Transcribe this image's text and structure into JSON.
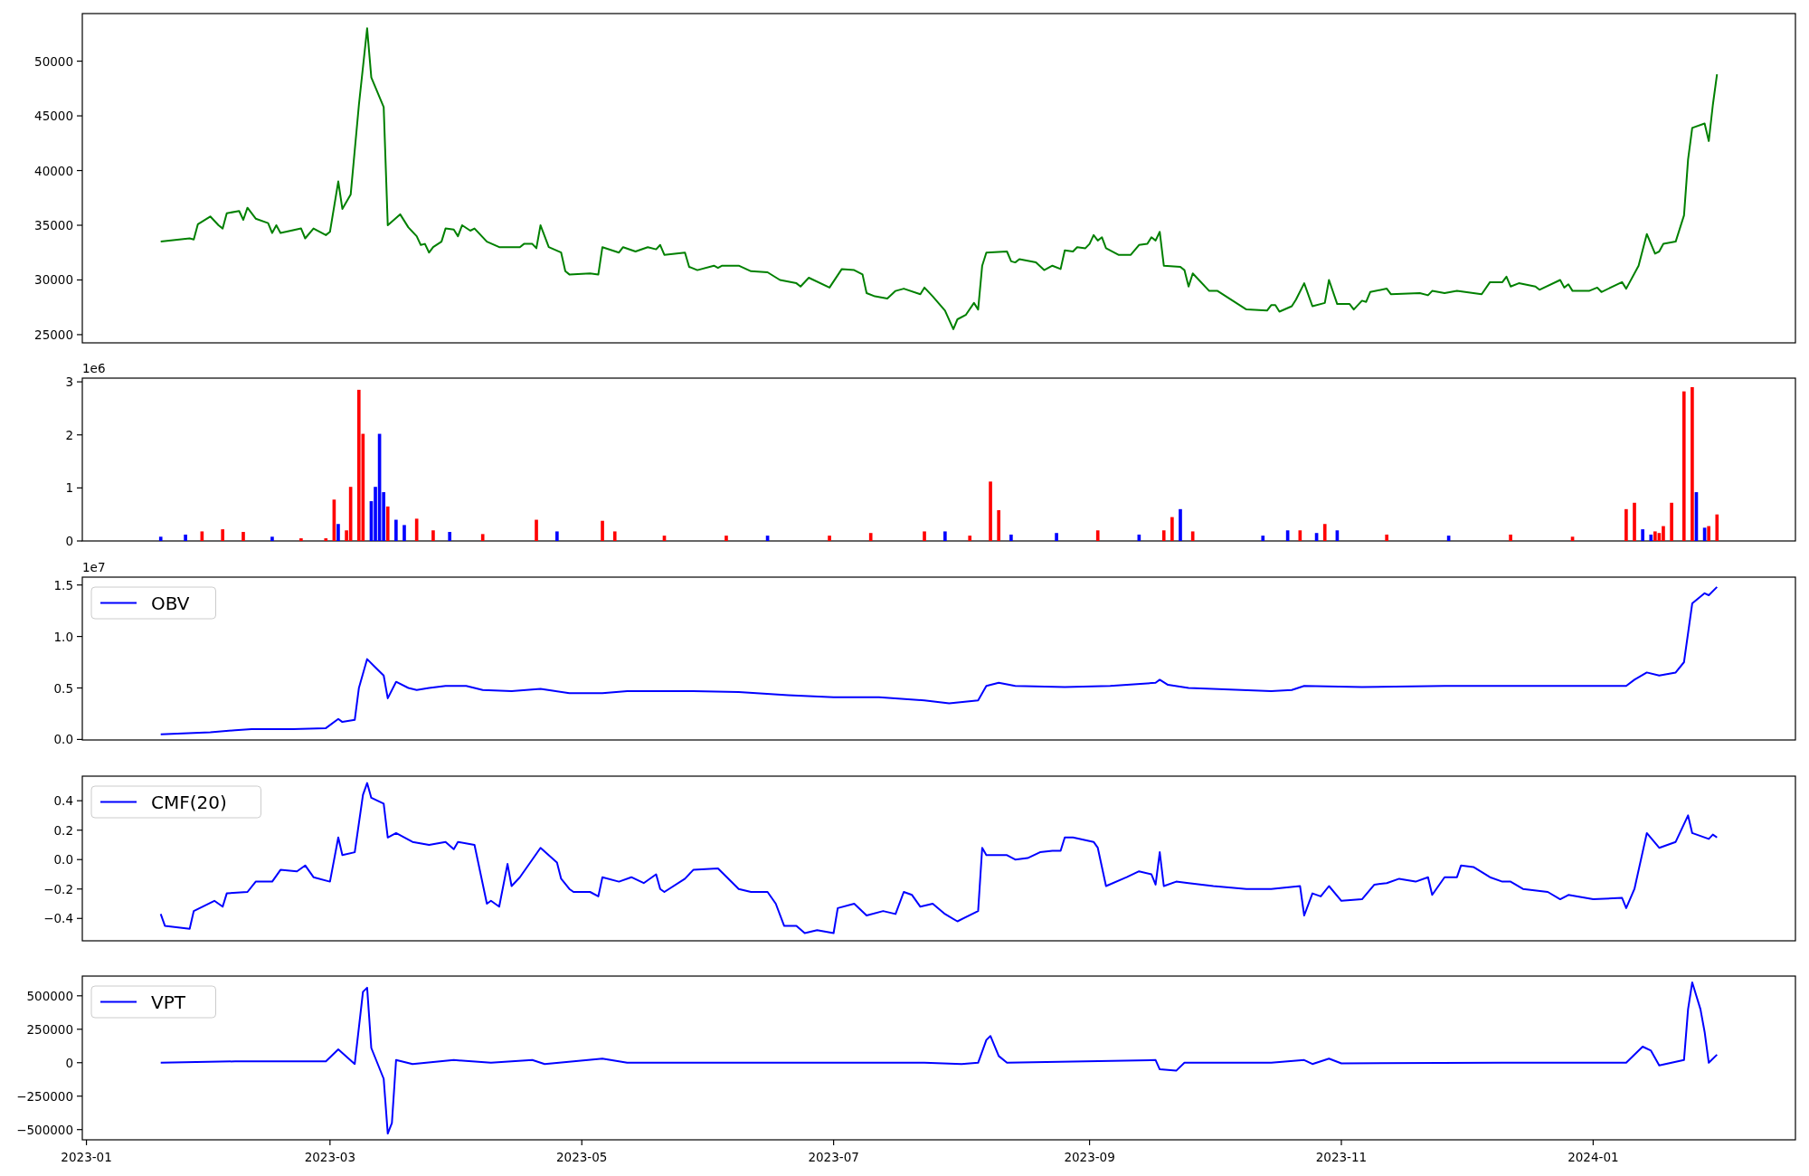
{
  "panels": [
    {
      "chart_data": {
        "type": "line",
        "xlim": [
          "2022-12-31",
          "2024-02-19"
        ],
        "ylim": [
          24250,
          54350
        ],
        "yticks": [
          25000,
          30000,
          35000,
          40000,
          45000,
          50000
        ],
        "x": [
          "2023-01-19",
          "2023-01-26",
          "2023-01-27",
          "2023-01-28",
          "2023-01-31",
          "2023-02-02",
          "2023-02-03",
          "2023-02-04",
          "2023-02-07",
          "2023-02-08",
          "2023-02-09",
          "2023-02-11",
          "2023-02-14",
          "2023-02-15",
          "2023-02-16",
          "2023-02-17",
          "2023-02-22",
          "2023-02-23",
          "2023-02-25",
          "2023-02-28",
          "2023-03-01",
          "2023-03-03",
          "2023-03-04",
          "2023-03-06",
          "2023-03-08",
          "2023-03-10",
          "2023-03-11",
          "2023-03-14",
          "2023-03-15",
          "2023-03-18",
          "2023-03-20",
          "2023-03-22",
          "2023-03-23",
          "2023-03-24",
          "2023-03-25",
          "2023-03-26",
          "2023-03-28",
          "2023-03-29",
          "2023-03-31",
          "2023-04-01",
          "2023-04-02",
          "2023-04-04",
          "2023-04-05",
          "2023-04-08",
          "2023-04-11",
          "2023-04-16",
          "2023-04-17",
          "2023-04-19",
          "2023-04-20",
          "2023-04-21",
          "2023-04-23",
          "2023-04-26",
          "2023-04-27",
          "2023-04-28",
          "2023-05-03",
          "2023-05-05",
          "2023-05-06",
          "2023-05-10",
          "2023-05-11",
          "2023-05-14",
          "2023-05-17",
          "2023-05-19",
          "2023-05-20",
          "2023-05-21",
          "2023-05-26",
          "2023-05-27",
          "2023-05-29",
          "2023-06-02",
          "2023-06-03",
          "2023-06-04",
          "2023-06-08",
          "2023-06-11",
          "2023-06-15",
          "2023-06-18",
          "2023-06-22",
          "2023-06-23",
          "2023-06-25",
          "2023-06-30",
          "2023-07-03",
          "2023-07-06",
          "2023-07-08",
          "2023-07-09",
          "2023-07-11",
          "2023-07-14",
          "2023-07-16",
          "2023-07-18",
          "2023-07-22",
          "2023-07-23",
          "2023-07-25",
          "2023-07-28",
          "2023-07-30",
          "2023-07-31",
          "2023-08-02",
          "2023-08-04",
          "2023-08-05",
          "2023-08-06",
          "2023-08-07",
          "2023-08-12",
          "2023-08-13",
          "2023-08-14",
          "2023-08-15",
          "2023-08-19",
          "2023-08-21",
          "2023-08-23",
          "2023-08-25",
          "2023-08-26",
          "2023-08-28",
          "2023-08-29",
          "2023-08-31",
          "2023-09-01",
          "2023-09-02",
          "2023-09-03",
          "2023-09-04",
          "2023-09-05",
          "2023-09-08",
          "2023-09-11",
          "2023-09-13",
          "2023-09-15",
          "2023-09-16",
          "2023-09-17",
          "2023-09-18",
          "2023-09-19",
          "2023-09-23",
          "2023-09-24",
          "2023-09-25",
          "2023-09-26",
          "2023-09-30",
          "2023-10-02",
          "2023-10-09",
          "2023-10-14",
          "2023-10-15",
          "2023-10-16",
          "2023-10-17",
          "2023-10-20",
          "2023-10-21",
          "2023-10-23",
          "2023-10-25",
          "2023-10-28",
          "2023-10-29",
          "2023-10-31",
          "2023-11-03",
          "2023-11-04",
          "2023-11-06",
          "2023-11-07",
          "2023-11-08",
          "2023-11-12",
          "2023-11-13",
          "2023-11-20",
          "2023-11-22",
          "2023-11-23",
          "2023-11-26",
          "2023-11-29",
          "2023-12-05",
          "2023-12-07",
          "2023-12-10",
          "2023-12-11",
          "2023-12-12",
          "2023-12-14",
          "2023-12-18",
          "2023-12-19",
          "2023-12-24",
          "2023-12-25",
          "2023-12-26",
          "2023-12-27",
          "2023-12-31",
          "2024-01-02",
          "2024-01-03",
          "2024-01-08",
          "2024-01-09",
          "2024-01-12",
          "2024-01-14",
          "2024-01-16",
          "2024-01-17",
          "2024-01-18",
          "2024-01-21",
          "2024-01-23",
          "2024-01-24",
          "2024-01-25",
          "2024-01-28",
          "2024-01-29",
          "2024-01-30",
          "2024-01-31"
        ],
        "series": [
          {
            "color": "#008000",
            "values": [
              33500,
              33800,
              33700,
              35100,
              35800,
              35000,
              34700,
              36100,
              36300,
              35500,
              36600,
              35600,
              35200,
              34300,
              35000,
              34300,
              34700,
              33800,
              34700,
              34100,
              34400,
              39000,
              36500,
              37800,
              46000,
              53000,
              48500,
              45800,
              35000,
              36000,
              34800,
              34000,
              33200,
              33300,
              32500,
              33000,
              33500,
              34700,
              34600,
              34000,
              35000,
              34500,
              34700,
              33500,
              33000,
              33000,
              33300,
              33300,
              32900,
              35000,
              33000,
              32500,
              30800,
              30500,
              30600,
              30500,
              33000,
              32500,
              33000,
              32600,
              33000,
              32800,
              33200,
              32300,
              32500,
              31200,
              30900,
              31300,
              31100,
              31300,
              31300,
              30800,
              30700,
              30000,
              29700,
              29400,
              30200,
              29300,
              31000,
              30900,
              30500,
              28800,
              28500,
              28300,
              29000,
              29200,
              28700,
              29300,
              28500,
              27200,
              25500,
              26400,
              26800,
              27900,
              27300,
              31300,
              32500,
              32600,
              31700,
              31600,
              31900,
              31600,
              30900,
              31300,
              31000,
              32700,
              32600,
              33000,
              32900,
              33300,
              34100,
              33600,
              33900,
              32900,
              32300,
              32300,
              33200,
              33300,
              33900,
              33600,
              34400,
              31300,
              31200,
              30900,
              29400,
              30600,
              29000,
              29000,
              27300,
              27200,
              27700,
              27700,
              27100,
              27600,
              28200,
              29700,
              27600,
              27900,
              30000,
              27800,
              27800,
              27300,
              28100,
              28000,
              28900,
              29200,
              28700,
              28800,
              28600,
              29000,
              28800,
              29000,
              28700,
              29800,
              29800,
              30300,
              29400,
              29700,
              29400,
              29100,
              30000,
              29300,
              29600,
              29000,
              29000,
              29300,
              28900,
              29800,
              29200,
              31300,
              34200,
              32400,
              32600,
              33300,
              33500,
              35900,
              41000,
              43900,
              44300,
              42700,
              46000,
              48800
            ]
          }
        ]
      }
    },
    {
      "offset_label": "1e6",
      "chart_data": {
        "type": "bar",
        "xlim": [
          "2022-12-31",
          "2024-02-19"
        ],
        "ylim": [
          0,
          3.07
        ],
        "yticks": [
          0,
          1,
          2,
          3
        ],
        "x": [
          "2023-01-19",
          "2023-01-25",
          "2023-01-29",
          "2023-02-03",
          "2023-02-08",
          "2023-02-15",
          "2023-02-22",
          "2023-02-28",
          "2023-03-02",
          "2023-03-03",
          "2023-03-05",
          "2023-03-06",
          "2023-03-08",
          "2023-03-09",
          "2023-03-11",
          "2023-03-12",
          "2023-03-13",
          "2023-03-14",
          "2023-03-15",
          "2023-03-17",
          "2023-03-19",
          "2023-03-22",
          "2023-03-26",
          "2023-03-30",
          "2023-04-07",
          "2023-04-20",
          "2023-04-25",
          "2023-05-06",
          "2023-05-09",
          "2023-05-21",
          "2023-06-05",
          "2023-06-15",
          "2023-06-30",
          "2023-07-10",
          "2023-07-23",
          "2023-07-28",
          "2023-08-03",
          "2023-08-08",
          "2023-08-10",
          "2023-08-13",
          "2023-08-24",
          "2023-09-03",
          "2023-09-13",
          "2023-09-19",
          "2023-09-21",
          "2023-09-23",
          "2023-09-26",
          "2023-10-13",
          "2023-10-19",
          "2023-10-22",
          "2023-10-26",
          "2023-10-28",
          "2023-10-31",
          "2023-11-12",
          "2023-11-27",
          "2023-12-12",
          "2023-12-27",
          "2024-01-09",
          "2024-01-11",
          "2024-01-13",
          "2024-01-15",
          "2024-01-16",
          "2024-01-17",
          "2024-01-18",
          "2024-01-20",
          "2024-01-23",
          "2024-01-25",
          "2024-01-26",
          "2024-01-28",
          "2024-01-29",
          "2024-01-31"
        ],
        "series": [
          {
            "color": "#ff0000",
            "values": [
              null,
              null,
              0.18,
              0.22,
              0.17,
              null,
              0.05,
              0.05,
              0.78,
              null,
              0.2,
              1.02,
              2.85,
              2.02,
              null,
              null,
              null,
              null,
              0.65,
              null,
              null,
              0.42,
              0.2,
              null,
              0.13,
              0.4,
              null,
              0.38,
              0.18,
              0.1,
              0.1,
              null,
              0.1,
              0.15,
              0.18,
              null,
              0.1,
              1.12,
              0.58,
              null,
              null,
              0.2,
              null,
              0.2,
              0.45,
              null,
              0.18,
              null,
              null,
              0.2,
              null,
              0.32,
              null,
              0.12,
              null,
              0.12,
              0.08,
              0.6,
              0.72,
              null,
              null,
              0.18,
              0.15,
              0.28,
              0.72,
              2.82,
              2.9,
              null,
              null,
              0.28,
              0.5
            ]
          },
          {
            "color": "#0000ff",
            "values": [
              0.08,
              0.12,
              null,
              null,
              null,
              0.08,
              null,
              null,
              null,
              0.32,
              null,
              null,
              null,
              null,
              0.75,
              1.02,
              2.02,
              0.92,
              null,
              0.4,
              0.3,
              null,
              null,
              0.17,
              null,
              null,
              0.18,
              null,
              null,
              null,
              null,
              0.1,
              null,
              null,
              null,
              0.18,
              null,
              null,
              null,
              0.12,
              0.15,
              null,
              0.12,
              null,
              null,
              0.6,
              null,
              0.1,
              0.2,
              null,
              0.15,
              null,
              0.2,
              null,
              0.1,
              null,
              null,
              null,
              null,
              0.22,
              0.12,
              null,
              null,
              null,
              null,
              null,
              null,
              0.92,
              0.25,
              null,
              null
            ]
          }
        ]
      }
    },
    {
      "offset_label": "1e7",
      "chart_data": {
        "type": "line",
        "xlim": [
          "2022-12-31",
          "2024-02-19"
        ],
        "ylim": [
          -0.005,
          1.576
        ],
        "yticks": [
          {
            "value": 0,
            "label": "0.0"
          },
          {
            "value": 0.5,
            "label": "0.5"
          },
          {
            "value": 1,
            "label": "1.0"
          },
          {
            "value": 1.5,
            "label": "1.5"
          }
        ],
        "x": [
          "2023-01-19",
          "2023-01-31",
          "2023-02-06",
          "2023-02-10",
          "2023-02-20",
          "2023-02-28",
          "2023-03-03",
          "2023-03-04",
          "2023-03-07",
          "2023-03-08",
          "2023-03-10",
          "2023-03-12",
          "2023-03-14",
          "2023-03-15",
          "2023-03-17",
          "2023-03-20",
          "2023-03-22",
          "2023-03-25",
          "2023-03-29",
          "2023-04-03",
          "2023-04-07",
          "2023-04-14",
          "2023-04-21",
          "2023-04-28",
          "2023-05-06",
          "2023-05-12",
          "2023-05-28",
          "2023-06-08",
          "2023-06-20",
          "2023-07-01",
          "2023-07-12",
          "2023-07-23",
          "2023-07-29",
          "2023-08-05",
          "2023-08-07",
          "2023-08-10",
          "2023-08-14",
          "2023-08-26",
          "2023-09-06",
          "2023-09-17",
          "2023-09-18",
          "2023-09-20",
          "2023-09-25",
          "2023-10-15",
          "2023-10-20",
          "2023-10-23",
          "2023-11-06",
          "2023-11-26",
          "2023-12-10",
          "2023-12-24",
          "2024-01-09",
          "2024-01-11",
          "2024-01-14",
          "2024-01-17",
          "2024-01-21",
          "2024-01-23",
          "2024-01-25",
          "2024-01-28",
          "2024-01-29",
          "2024-01-31"
        ],
        "series": [
          {
            "name": "OBV",
            "color": "#0000ff",
            "values": [
              0.05,
              0.07,
              0.09,
              0.1,
              0.1,
              0.11,
              0.2,
              0.17,
              0.19,
              0.5,
              0.78,
              0.7,
              0.62,
              0.4,
              0.56,
              0.5,
              0.48,
              0.5,
              0.52,
              0.52,
              0.48,
              0.47,
              0.49,
              0.45,
              0.45,
              0.47,
              0.47,
              0.46,
              0.43,
              0.41,
              0.41,
              0.38,
              0.35,
              0.38,
              0.52,
              0.55,
              0.52,
              0.51,
              0.52,
              0.55,
              0.58,
              0.53,
              0.5,
              0.47,
              0.48,
              0.52,
              0.51,
              0.52,
              0.52,
              0.52,
              0.52,
              0.58,
              0.65,
              0.62,
              0.65,
              0.75,
              1.32,
              1.42,
              1.4,
              1.48
            ]
          }
        ]
      }
    },
    {
      "chart_data": {
        "type": "line",
        "xlim": [
          "2022-12-31",
          "2024-02-19"
        ],
        "ylim": [
          -0.552,
          0.567
        ],
        "yticks": [
          {
            "value": -0.4,
            "label": "−0.4"
          },
          {
            "value": -0.2,
            "label": "−0.2"
          },
          {
            "value": 0,
            "label": "0.0"
          },
          {
            "value": 0.2,
            "label": "0.2"
          },
          {
            "value": 0.4,
            "label": "0.4"
          }
        ],
        "x": [
          "2023-01-19",
          "2023-01-20",
          "2023-01-26",
          "2023-01-27",
          "2023-02-01",
          "2023-02-03",
          "2023-02-04",
          "2023-02-09",
          "2023-02-11",
          "2023-02-15",
          "2023-02-17",
          "2023-02-21",
          "2023-02-23",
          "2023-02-25",
          "2023-03-01",
          "2023-03-03",
          "2023-03-04",
          "2023-03-07",
          "2023-03-09",
          "2023-03-10",
          "2023-03-11",
          "2023-03-14",
          "2023-03-15",
          "2023-03-17",
          "2023-03-21",
          "2023-03-25",
          "2023-03-29",
          "2023-03-31",
          "2023-04-01",
          "2023-04-05",
          "2023-04-08",
          "2023-04-09",
          "2023-04-11",
          "2023-04-13",
          "2023-04-14",
          "2023-04-16",
          "2023-04-21",
          "2023-04-25",
          "2023-04-26",
          "2023-04-28",
          "2023-04-29",
          "2023-05-03",
          "2023-05-05",
          "2023-05-06",
          "2023-05-10",
          "2023-05-13",
          "2023-05-16",
          "2023-05-19",
          "2023-05-20",
          "2023-05-21",
          "2023-05-26",
          "2023-05-28",
          "2023-06-03",
          "2023-06-08",
          "2023-06-11",
          "2023-06-15",
          "2023-06-17",
          "2023-06-19",
          "2023-06-22",
          "2023-06-24",
          "2023-06-27",
          "2023-07-01",
          "2023-07-02",
          "2023-07-06",
          "2023-07-09",
          "2023-07-13",
          "2023-07-16",
          "2023-07-18",
          "2023-07-20",
          "2023-07-22",
          "2023-07-25",
          "2023-07-28",
          "2023-07-31",
          "2023-08-05",
          "2023-08-06",
          "2023-08-07",
          "2023-08-12",
          "2023-08-14",
          "2023-08-17",
          "2023-08-20",
          "2023-08-23",
          "2023-08-25",
          "2023-08-26",
          "2023-08-28",
          "2023-09-02",
          "2023-09-03",
          "2023-09-05",
          "2023-09-10",
          "2023-09-13",
          "2023-09-16",
          "2023-09-17",
          "2023-09-18",
          "2023-09-19",
          "2023-09-22",
          "2023-09-25",
          "2023-10-01",
          "2023-10-09",
          "2023-10-15",
          "2023-10-22",
          "2023-10-23",
          "2023-10-25",
          "2023-10-27",
          "2023-10-29",
          "2023-11-01",
          "2023-11-06",
          "2023-11-09",
          "2023-11-12",
          "2023-11-15",
          "2023-11-19",
          "2023-11-22",
          "2023-11-23",
          "2023-11-26",
          "2023-11-29",
          "2023-11-30",
          "2023-12-03",
          "2023-12-07",
          "2023-12-10",
          "2023-12-12",
          "2023-12-15",
          "2023-12-21",
          "2023-12-24",
          "2023-12-26",
          "2024-01-01",
          "2024-01-08",
          "2024-01-09",
          "2024-01-11",
          "2024-01-14",
          "2024-01-17",
          "2024-01-21",
          "2024-01-24",
          "2024-01-25",
          "2024-01-29",
          "2024-01-30",
          "2024-01-31"
        ],
        "series": [
          {
            "name": "CMF(20)",
            "color": "#0000ff",
            "values": [
              -0.37,
              -0.45,
              -0.47,
              -0.35,
              -0.28,
              -0.32,
              -0.23,
              -0.22,
              -0.15,
              -0.15,
              -0.07,
              -0.08,
              -0.04,
              -0.12,
              -0.15,
              0.15,
              0.03,
              0.05,
              0.44,
              0.52,
              0.42,
              0.38,
              0.15,
              0.18,
              0.12,
              0.1,
              0.12,
              0.07,
              0.12,
              0.1,
              -0.3,
              -0.28,
              -0.32,
              -0.03,
              -0.18,
              -0.12,
              0.08,
              -0.02,
              -0.13,
              -0.2,
              -0.22,
              -0.22,
              -0.25,
              -0.12,
              -0.15,
              -0.12,
              -0.16,
              -0.1,
              -0.2,
              -0.22,
              -0.13,
              -0.07,
              -0.06,
              -0.2,
              -0.22,
              -0.22,
              -0.3,
              -0.45,
              -0.45,
              -0.5,
              -0.48,
              -0.5,
              -0.33,
              -0.3,
              -0.38,
              -0.35,
              -0.37,
              -0.22,
              -0.24,
              -0.32,
              -0.3,
              -0.37,
              -0.42,
              -0.35,
              0.08,
              0.03,
              0.03,
              0.0,
              0.01,
              0.05,
              0.06,
              0.06,
              0.15,
              0.15,
              0.12,
              0.08,
              -0.18,
              -0.12,
              -0.08,
              -0.1,
              -0.17,
              0.05,
              -0.18,
              -0.15,
              -0.16,
              -0.18,
              -0.2,
              -0.2,
              -0.18,
              -0.38,
              -0.23,
              -0.25,
              -0.18,
              -0.28,
              -0.27,
              -0.17,
              -0.16,
              -0.13,
              -0.15,
              -0.12,
              -0.24,
              -0.12,
              -0.12,
              -0.04,
              -0.05,
              -0.12,
              -0.15,
              -0.15,
              -0.2,
              -0.22,
              -0.27,
              -0.24,
              -0.27,
              -0.26,
              -0.33,
              -0.2,
              0.18,
              0.08,
              0.12,
              0.3,
              0.18,
              0.14,
              0.17,
              0.15
            ]
          }
        ]
      }
    },
    {
      "chart_data": {
        "type": "line",
        "xlim": [
          "2022-12-31",
          "2024-02-19"
        ],
        "ylim": [
          -576400,
          647400
        ],
        "yticks": [
          {
            "value": -500000,
            "label": "−500000"
          },
          {
            "value": -250000,
            "label": "−250000"
          },
          {
            "value": 0,
            "label": "0"
          },
          {
            "value": 250000,
            "label": "250000"
          },
          {
            "value": 500000,
            "label": "500000"
          }
        ],
        "xticks": [
          {
            "value": "2023-01-01",
            "label": "2023-01"
          },
          {
            "value": "2023-03-01",
            "label": "2023-03"
          },
          {
            "value": "2023-05-01",
            "label": "2023-05"
          },
          {
            "value": "2023-07-01",
            "label": "2023-07"
          },
          {
            "value": "2023-09-01",
            "label": "2023-09"
          },
          {
            "value": "2023-11-01",
            "label": "2023-11"
          },
          {
            "value": "2024-01-01",
            "label": "2024-01"
          }
        ],
        "x": [
          "2023-01-19",
          "2023-02-06",
          "2023-02-28",
          "2023-03-03",
          "2023-03-07",
          "2023-03-09",
          "2023-03-10",
          "2023-03-11",
          "2023-03-14",
          "2023-03-15",
          "2023-03-16",
          "2023-03-17",
          "2023-03-21",
          "2023-03-31",
          "2023-04-09",
          "2023-04-19",
          "2023-04-22",
          "2023-05-06",
          "2023-05-12",
          "2023-06-25",
          "2023-07-23",
          "2023-08-01",
          "2023-08-05",
          "2023-08-07",
          "2023-08-08",
          "2023-08-10",
          "2023-08-12",
          "2023-09-17",
          "2023-09-18",
          "2023-09-22",
          "2023-09-24",
          "2023-10-15",
          "2023-10-23",
          "2023-10-25",
          "2023-10-29",
          "2023-11-01",
          "2023-12-10",
          "2024-01-09",
          "2024-01-13",
          "2024-01-15",
          "2024-01-17",
          "2024-01-23",
          "2024-01-24",
          "2024-01-25",
          "2024-01-27",
          "2024-01-28",
          "2024-01-29",
          "2024-01-31"
        ],
        "series": [
          {
            "name": "VPT",
            "color": "#0000ff",
            "values": [
              0,
              10000,
              10000,
              100000,
              -10000,
              530000,
              560000,
              110000,
              -120000,
              -530000,
              -450000,
              20000,
              -10000,
              20000,
              0,
              20000,
              -10000,
              30000,
              0,
              0,
              0,
              -10000,
              0,
              170000,
              200000,
              50000,
              0,
              20000,
              -50000,
              -60000,
              0,
              0,
              20000,
              -10000,
              30000,
              -5000,
              0,
              0,
              120000,
              90000,
              -20000,
              20000,
              400000,
              600000,
              400000,
              230000,
              0,
              60000
            ]
          }
        ]
      }
    }
  ]
}
